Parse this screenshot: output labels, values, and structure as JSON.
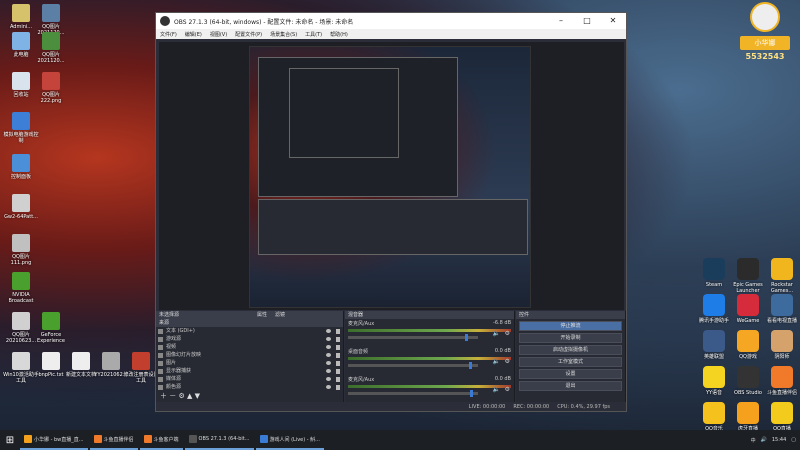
{
  "desktop_left": [
    {
      "label": "Admini...",
      "color": "#d6c26b"
    },
    {
      "label": "QQ图片2021120...",
      "color": "#5c7fa6"
    },
    {
      "label": "此电脑",
      "color": "#7fb3e6"
    },
    {
      "label": "QQ图片2021120...",
      "color": "#4b8f3e"
    },
    {
      "label": "回收站",
      "color": "#d9e3ee"
    },
    {
      "label": "QQ图片222.png",
      "color": "#c4433a"
    },
    {
      "label": "模拟电脑游戏控制",
      "color": "#3d7ed6"
    },
    {
      "label": "控制面板",
      "color": "#4a8fd8"
    },
    {
      "label": "Gw2-64Patt...",
      "color": "#d0d0d0"
    },
    {
      "label": "QQ图片111.png",
      "color": "#c0c0c0"
    },
    {
      "label": "NVIDIA Broadcast",
      "color": "#4aa02c"
    },
    {
      "label": "QQ图片20210623...",
      "color": "#d0d0d0"
    },
    {
      "label": "GeForce Experience",
      "color": "#4aa02c"
    },
    {
      "label": "Win10激活助手工具",
      "color": "#d8d8d8"
    },
    {
      "label": "bnpPic.txt",
      "color": "#eeeeee"
    },
    {
      "label": "新建文本文档",
      "color": "#eeeeee"
    },
    {
      "label": "YY2021062...",
      "color": "#aaaaaa"
    },
    {
      "label": "修改注册表设置工具",
      "color": "#c23f2e"
    },
    {
      "label": "新建文本文档.txt",
      "color": "#eeeeee"
    }
  ],
  "desktop_right": [
    {
      "label": "Steam",
      "color": "#1b3d5c"
    },
    {
      "label": "Epic Games Launcher",
      "color": "#2b2b2b"
    },
    {
      "label": "Rockstar Games...",
      "color": "#f1b61d"
    },
    {
      "label": "腾讯手游助手",
      "color": "#1f7de8"
    },
    {
      "label": "WeGame",
      "color": "#d62b3a"
    },
    {
      "label": "看看电视直播",
      "color": "#3d6b9e"
    },
    {
      "label": "英雄联盟",
      "color": "#3b5a8a"
    },
    {
      "label": "QQ游戏",
      "color": "#f5a623"
    },
    {
      "label": "阴阳师",
      "color": "#d6a26b"
    },
    {
      "label": "YY语音",
      "color": "#f5d321"
    },
    {
      "label": "OBS Studio",
      "color": "#333333"
    },
    {
      "label": "斗鱼直播伴侣",
      "color": "#f07a2a"
    },
    {
      "label": "QQ音乐",
      "color": "#f5c21d"
    },
    {
      "label": "虎牙直播",
      "color": "#f6a11e"
    },
    {
      "label": "QQ直播",
      "color": "#f2cb1c"
    },
    {
      "label": "QQ游戏",
      "color": "#f0c92d"
    },
    {
      "label": "Laser",
      "color": "#1f1f1f"
    },
    {
      "label": "《图图》",
      "color": "#d83c3c"
    },
    {
      "label": "网易云音乐",
      "color": "#e0333a"
    },
    {
      "label": "QQ音乐",
      "color": "#f2c12e"
    }
  ],
  "streamer": {
    "name": "小华娜",
    "id": "5532543"
  },
  "obs": {
    "title": "OBS 27.1.3 (64-bit, windows) - 配置文件: 未命名 - 场景: 未命名",
    "menu": [
      "文件(F)",
      "编辑(E)",
      "视图(V)",
      "配置文件(P)",
      "场景集合(S)",
      "工具(T)",
      "帮助(H)"
    ],
    "scenes_header": "未选择源",
    "props_label": "属性",
    "filters_label": "滤镜",
    "sources_header": "来源",
    "sources": [
      "文本 (GDI+)",
      "游戏源",
      "视频",
      "图像幻灯片放映",
      "图片",
      "显示器捕获",
      "媒体源",
      "颜色源"
    ],
    "mixer_header": "混音器",
    "channels": [
      {
        "name": "麦克风/Aux",
        "db": "-6.8 dB",
        "vol": 0.92
      },
      {
        "name": "桌面音频",
        "db": "0.0 dB",
        "vol": 0.95
      },
      {
        "name": "麦克风/Aux",
        "db": "0.0 dB",
        "vol": 0.96
      }
    ],
    "controls_header": "控件",
    "controls": [
      "停止推流",
      "开始录制",
      "启动虚拟摄像机",
      "工作室模式",
      "设置",
      "退出"
    ],
    "status": [
      "LIVE: 00:00:00",
      "REC: 00:00:00",
      "CPU: 0.4%, 29.97 fps"
    ]
  },
  "taskbar": {
    "items": [
      {
        "label": "小华娜 - bw直播_直...",
        "color": "#f6a11e"
      },
      {
        "label": "斗鱼直播伴侣",
        "color": "#f07a2a"
      },
      {
        "label": "斗鱼客户端",
        "color": "#f07a2a"
      },
      {
        "label": "OBS 27.1.3 (64-bit...",
        "color": "#555555"
      },
      {
        "label": "游戏人间 (Live) - 斛...",
        "color": "#3a7bd5"
      }
    ],
    "time": "15:44",
    "lang": "中"
  }
}
